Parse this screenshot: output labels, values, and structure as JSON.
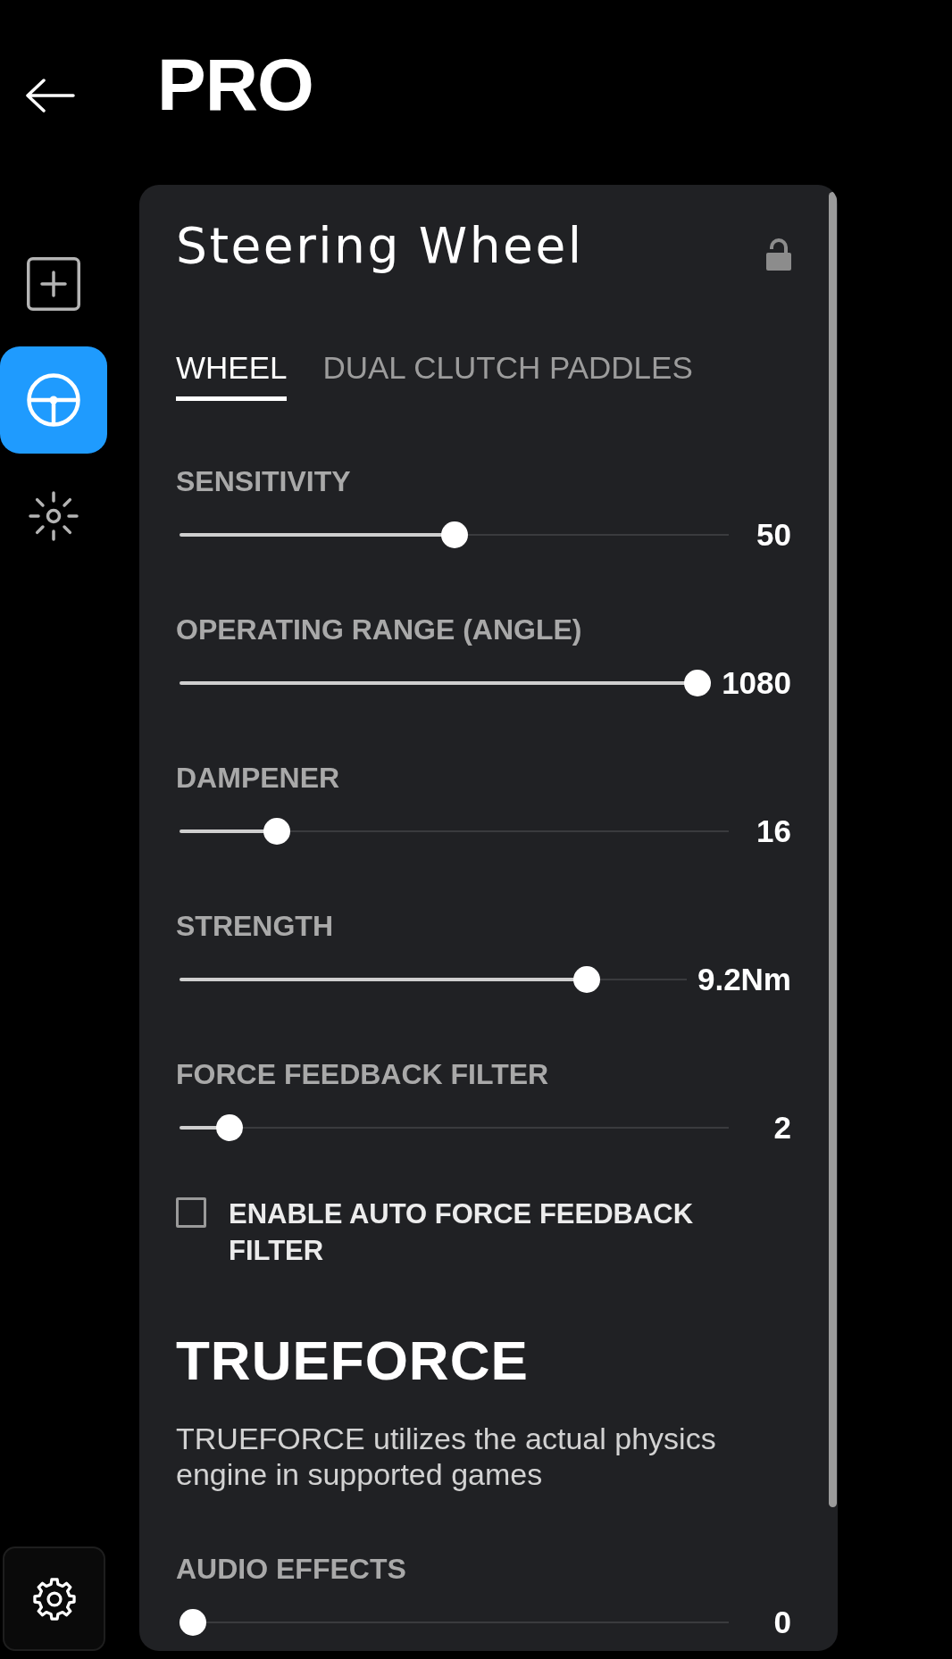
{
  "header": {
    "title": "PRO"
  },
  "sidebar": {
    "items": [
      {
        "kind": "add",
        "selected": false
      },
      {
        "kind": "wheel",
        "selected": true
      },
      {
        "kind": "lighting",
        "selected": false
      }
    ]
  },
  "panel": {
    "title": "Steering Wheel",
    "locked": false,
    "tabs": [
      {
        "label": "WHEEL",
        "selected": true
      },
      {
        "label": "DUAL CLUTCH PADDLES",
        "selected": false
      }
    ],
    "sliders": [
      {
        "label": "SENSITIVITY",
        "level": 0.5,
        "reading": "50"
      },
      {
        "label": "OPERATING RANGE (ANGLE)",
        "level": 1,
        "reading": "1080"
      },
      {
        "label": "DAMPENER",
        "level": 0.16,
        "reading": "16"
      },
      {
        "label": "STRENGTH",
        "level": 0.82,
        "reading": "9.2Nm"
      },
      {
        "label": "FORCE FEEDBACK FILTER",
        "level": 0.07,
        "reading": "2"
      }
    ],
    "auto_filter": {
      "label": "ENABLE AUTO FORCE FEEDBACK FILTER",
      "checked": false
    },
    "trueforce": {
      "logo": "TRUEFORCE",
      "description": "TRUEFORCE utilizes the actual physics engine in supported games",
      "sliders": [
        {
          "label": "AUDIO EFFECTS",
          "level": 0,
          "reading": "0"
        }
      ]
    }
  }
}
